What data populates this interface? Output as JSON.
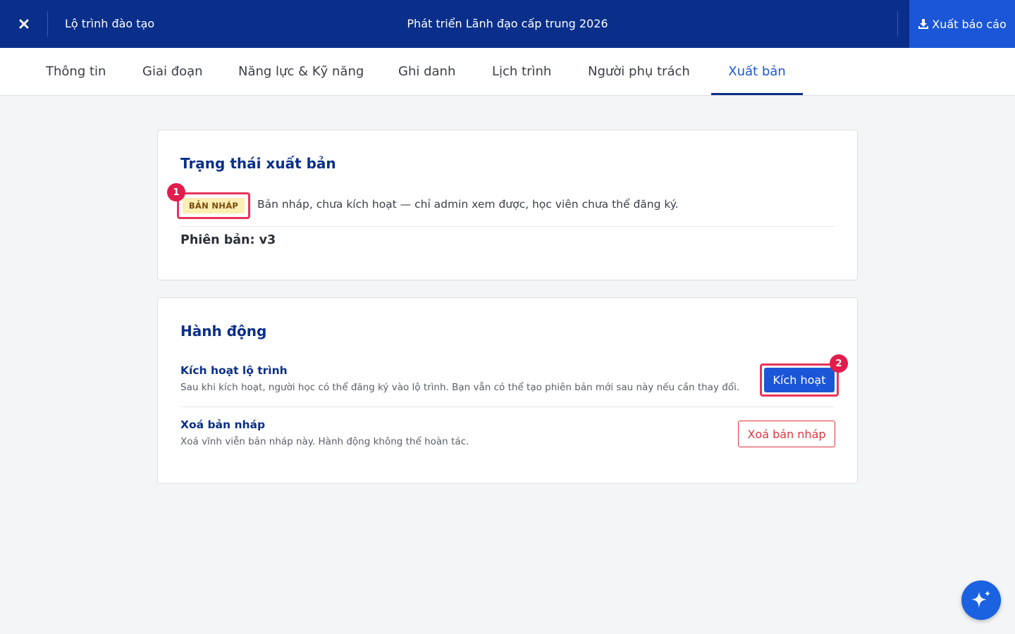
{
  "header": {
    "close_icon": "close-icon",
    "breadcrumb": "Lộ trình đào tạo",
    "title": "Phát triển Lãnh đạo cấp trung 2026",
    "export_label": "Xuất báo cáo",
    "export_icon": "download-icon",
    "background_color": "#0a2f8a",
    "export_button_color": "#1b56d8"
  },
  "tabs": [
    {
      "label": "Thông tin",
      "active": false
    },
    {
      "label": "Giai đoạn",
      "active": false
    },
    {
      "label": "Năng lực & Kỹ năng",
      "active": false
    },
    {
      "label": "Ghi danh",
      "active": false
    },
    {
      "label": "Lịch trình",
      "active": false
    },
    {
      "label": "Người phụ trách",
      "active": false
    },
    {
      "label": "Xuất bản",
      "active": true
    }
  ],
  "publish_status": {
    "title": "Trạng thái xuất bản",
    "badge": "BẢN NHÁP",
    "description": "Bản nháp, chưa kích hoạt — chỉ admin xem được, học viên chưa thể đăng ký.",
    "version": "Phiên bản: v3"
  },
  "actions": {
    "title": "Hành động",
    "activate": {
      "title": "Kích hoạt lộ trình",
      "description": "Sau khi kích hoạt, người học có thể đăng ký vào lộ trình. Bạn vẫn có thể tạo phiên bản mới sau này nếu cần thay đổi.",
      "button": "Kích hoạt"
    },
    "delete": {
      "title": "Xoá bản nháp",
      "description": "Xoá vĩnh viễn bản nháp này. Hành động không thể hoàn tác.",
      "button": "Xoá bản nháp"
    }
  },
  "markers": [
    "1",
    "2"
  ],
  "fab_icon": "sparkle-icon",
  "colors": {
    "accent": "#1b56d8",
    "marker": "#e21d4d",
    "danger": "#e0353d",
    "badge_bg": "#fdeeb4"
  }
}
